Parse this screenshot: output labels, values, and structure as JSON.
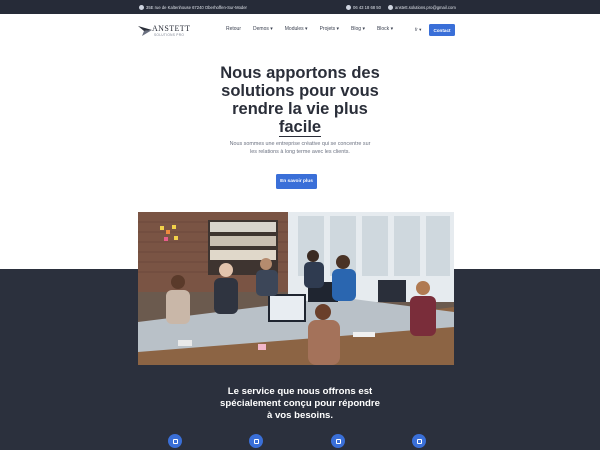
{
  "topbar": {
    "address": "35E rue de Kaltenhouse 67240 Oberhoffen-Sur-Moder",
    "phone": "06 43 18 68 50",
    "email": "anstett.solutions.pro@gmail.com"
  },
  "brand": {
    "name": "ANSTETT",
    "tagline": "SOLUTIONS PRO"
  },
  "nav": {
    "items": [
      {
        "label": "Retour"
      },
      {
        "label": "Demos ▾"
      },
      {
        "label": "Modules ▾"
      },
      {
        "label": "Projets ▾"
      },
      {
        "label": "Blog ▾"
      },
      {
        "label": "Block ▾"
      }
    ],
    "language": "fr ▾",
    "contact_label": "Contact"
  },
  "hero": {
    "title_line1": "Nous apportons des",
    "title_line2": "solutions pour vous",
    "title_line3": "rendre la vie plus",
    "title_underlined": "facile",
    "subtitle": "Nous sommes une entreprise créative qui se concentre sur les relations à long terme avec les clients.",
    "cta_label": "En savoir plus"
  },
  "services": {
    "title": "Le service que nous offrons est spécialement conçu pour répondre à vos besoins."
  },
  "colors": {
    "accent": "#3a6fd8",
    "dark_bg": "#2b303d",
    "topbar_bg": "#262b38"
  }
}
